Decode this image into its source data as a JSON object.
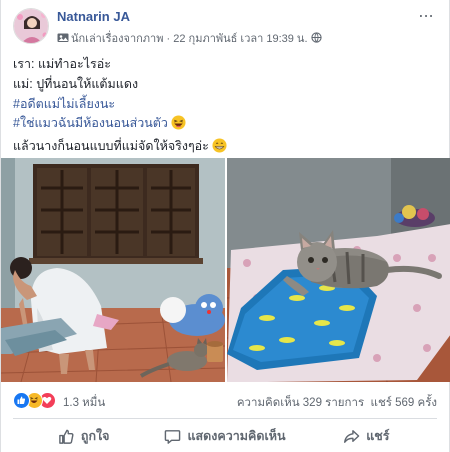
{
  "post": {
    "author": "Natnarin JA",
    "badge": "นักเล่าเรื่องจากภาพ",
    "separator": "·",
    "timestamp": "22 กุมภาพันธ์ เวลา 19:39 น.",
    "privacy_icon": "globe-icon",
    "more_label": "...",
    "lines": [
      "เรา: แม่ทำอะไรอ่ะ",
      "แม่: ปูที่นอนให้แต้มแดง",
      "#อดีตแม่ไม่เลี้ยงนะ",
      "#ใช่แมวฉันมีห้องนอนส่วนตัว",
      "แล้วนางก็นอนแบบที่แม่จัดให้จริงๆอ่ะ"
    ]
  },
  "photos": [
    {
      "name": "woman-making-bed-photo",
      "alt_icon": "photo-icon"
    },
    {
      "name": "cat-on-mattress-photo",
      "alt_icon": "photo-icon"
    }
  ],
  "stats": {
    "reaction_icons": [
      "like-reaction-icon",
      "haha-reaction-icon",
      "love-reaction-icon"
    ],
    "reaction_count": "1.3 หมื่น",
    "comments": "ความคิดเห็น 329 รายการ",
    "shares": "แชร์ 569 ครั้ง"
  },
  "actions": {
    "like": "ถูกใจ",
    "comment": "แสดงความคิดเห็น",
    "share": "แชร์"
  },
  "colors": {
    "link": "#385898",
    "muted": "#606770",
    "like_blue": "#1877f2",
    "love_red": "#f33e58",
    "haha_yellow": "#f7b928"
  }
}
